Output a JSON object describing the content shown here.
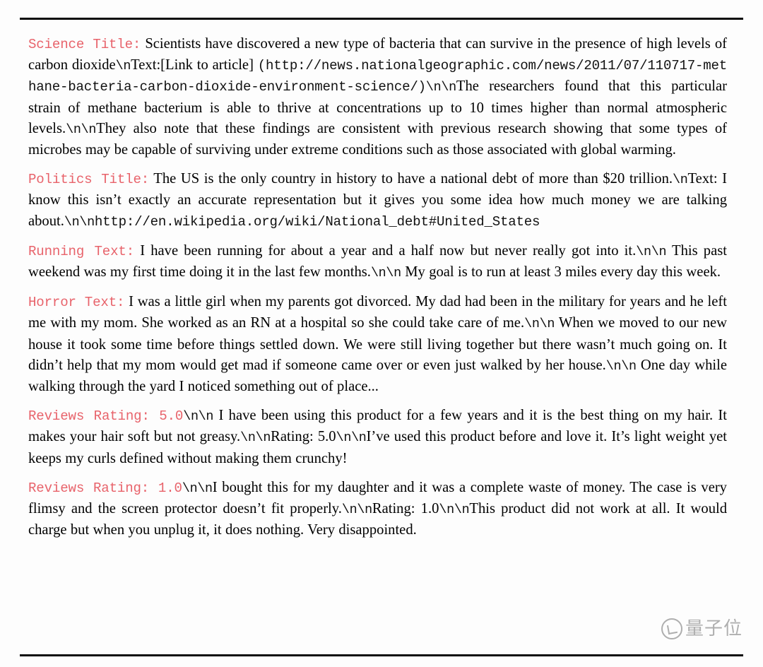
{
  "document": {
    "background_color": "#fdfdfd",
    "text_color": "#000000",
    "label_color": "#e8636b",
    "rule_color": "#0a0a0a"
  },
  "watermark": {
    "logo_name": "qbitai-circle-logo",
    "text": "量子位"
  },
  "sections": [
    {
      "id": "science",
      "label": "Science Title:",
      "parts": [
        {
          "style": "serif",
          "text": " Scientists have discovered a new type of bacteria that can survive in the presence of high levels of carbon dioxide"
        },
        {
          "style": "escape",
          "text": "\\n"
        },
        {
          "style": "serif",
          "text": "Text:[Link to article] "
        },
        {
          "style": "url",
          "text": "(http://news.nationalgeographic.com/news/2011/07/110717-methane-bacteria-carbon-dioxide-environment-science/)"
        },
        {
          "style": "escape",
          "text": "\\n\\n"
        },
        {
          "style": "serif",
          "text": "The researchers found that this particular strain of methane bacterium is able to thrive at concentrations up to 10 times higher than normal atmospheric levels."
        },
        {
          "style": "escape",
          "text": "\\n\\n"
        },
        {
          "style": "serif",
          "text": "They also note that these findings are consistent with previous research showing that some types of microbes may be capable of surviving under extreme conditions such as those associated with global warming."
        }
      ]
    },
    {
      "id": "politics",
      "label": "Politics Title:",
      "parts": [
        {
          "style": "serif",
          "text": " The US is the only country in history to have a national debt of more than $20 trillion."
        },
        {
          "style": "escape",
          "text": "\\n"
        },
        {
          "style": "serif",
          "text": "Text: I know this isn’t exactly an accurate representation but it gives you some idea how much money we are talking about."
        },
        {
          "style": "escape",
          "text": "\\n\\n"
        },
        {
          "style": "url",
          "text": "http://en.wikipedia.org/wiki/National_debt#United_States"
        }
      ]
    },
    {
      "id": "running",
      "label": "Running Text:",
      "parts": [
        {
          "style": "serif",
          "text": " I have been running for about a year and a half now but never really got into it."
        },
        {
          "style": "escape",
          "text": "\\n\\n"
        },
        {
          "style": "serif",
          "text": " This past weekend was my first time doing it in the last few months."
        },
        {
          "style": "escape",
          "text": "\\n\\n"
        },
        {
          "style": "serif",
          "text": " My goal is to run at least 3 miles every day this week."
        }
      ]
    },
    {
      "id": "horror",
      "label": "Horror Text:",
      "parts": [
        {
          "style": "serif",
          "text": " I was a little girl when my parents got divorced. My dad had been in the military for years and he left me with my mom. She worked as an RN at a hospital so she could take care of me."
        },
        {
          "style": "escape",
          "text": "\\n\\n"
        },
        {
          "style": "serif",
          "text": " When we moved to our new house it took some time before things settled down. We were still living together but there wasn’t much going on. It didn’t help that my mom would get mad if someone came over or even just walked by her house."
        },
        {
          "style": "escape",
          "text": "\\n\\n"
        },
        {
          "style": "serif",
          "text": " One day while walking through the yard I noticed something out of place..."
        }
      ]
    },
    {
      "id": "reviews-5",
      "label": "Reviews Rating: 5.0",
      "parts": [
        {
          "style": "escape",
          "text": "\\n\\n"
        },
        {
          "style": "serif",
          "text": " I have been using this product for a few years and it is the best thing on my hair. It makes your hair soft but not greasy."
        },
        {
          "style": "escape",
          "text": "\\n\\n"
        },
        {
          "style": "serif",
          "text": "Rating: 5.0"
        },
        {
          "style": "escape",
          "text": "\\n\\n"
        },
        {
          "style": "serif",
          "text": "I’ve used this product before and love it. It’s light weight yet keeps my curls defined without making them crunchy!"
        }
      ]
    },
    {
      "id": "reviews-1",
      "label": "Reviews Rating: 1.0",
      "parts": [
        {
          "style": "escape",
          "text": "\\n\\n"
        },
        {
          "style": "serif",
          "text": "I bought this for my daughter and it was a complete waste of money. The case is very flimsy and the screen protector doesn’t fit properly."
        },
        {
          "style": "escape",
          "text": "\\n\\n"
        },
        {
          "style": "serif",
          "text": "Rating: 1.0"
        },
        {
          "style": "escape",
          "text": "\\n\\n"
        },
        {
          "style": "serif",
          "text": "This product did not work at all. It would charge but when you unplug it, it does nothing. Very disappointed."
        }
      ]
    }
  ]
}
